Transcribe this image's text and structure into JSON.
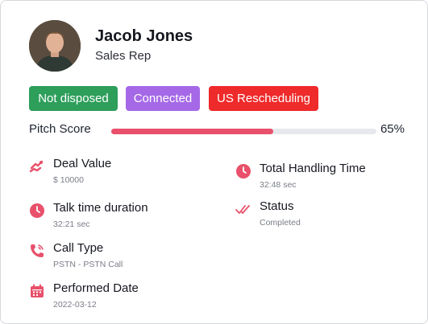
{
  "profile": {
    "name": "Jacob Jones",
    "role": "Sales Rep"
  },
  "badges": [
    {
      "label": "Not disposed",
      "color": "#2e9e5b"
    },
    {
      "label": "Connected",
      "color": "#a569e7"
    },
    {
      "label": "US Rescheduling",
      "color": "#ef2a2a"
    }
  ],
  "pitch": {
    "label": "Pitch Score",
    "value_text": "65%",
    "value": 0.61,
    "fill_color": "#e8506b"
  },
  "details": {
    "deal_value": {
      "title": "Deal Value",
      "value": "$ 10000",
      "icon": "money-transfer-icon"
    },
    "total_handling_time": {
      "title": "Total Handling Time",
      "value": "32:48 sec",
      "icon": "clock-icon"
    },
    "talk_time": {
      "title": "Talk time duration",
      "value": "32:21 sec",
      "icon": "clock-icon"
    },
    "status": {
      "title": "Status",
      "value": "Completed",
      "icon": "double-check-icon"
    },
    "call_type": {
      "title": "Call Type",
      "value": "PSTN - PSTN Call",
      "icon": "phone-icon"
    },
    "performed_date": {
      "title": "Performed Date",
      "value": "2022-03-12",
      "icon": "calendar-icon"
    }
  },
  "colors": {
    "accent": "#e8506b"
  }
}
